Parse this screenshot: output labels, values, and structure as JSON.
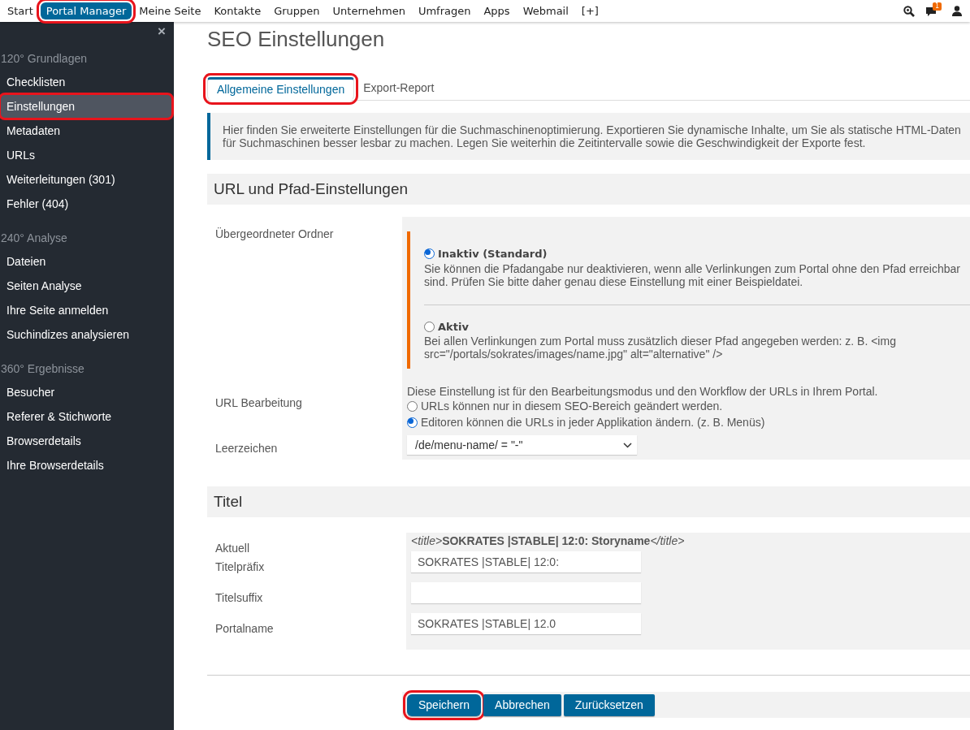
{
  "top_nav": {
    "items": [
      {
        "label": "Start",
        "selected": false,
        "highlighted": false
      },
      {
        "label": "Portal Manager",
        "selected": true,
        "highlighted": true
      },
      {
        "label": "Meine Seite",
        "selected": false,
        "highlighted": false
      },
      {
        "label": "Kontakte",
        "selected": false,
        "highlighted": false
      },
      {
        "label": "Gruppen",
        "selected": false,
        "highlighted": false
      },
      {
        "label": "Unternehmen",
        "selected": false,
        "highlighted": false
      },
      {
        "label": "Umfragen",
        "selected": false,
        "highlighted": false
      },
      {
        "label": "Apps",
        "selected": false,
        "highlighted": false
      },
      {
        "label": "Webmail",
        "selected": false,
        "highlighted": false
      },
      {
        "label": "[+]",
        "selected": false,
        "highlighted": false
      }
    ],
    "message_badge": "1"
  },
  "sidebar": {
    "close": "×",
    "sections": [
      {
        "title": "120° Grundlagen",
        "items": [
          {
            "label": "Checklisten",
            "selected": false,
            "highlighted": false
          },
          {
            "label": "Einstellungen",
            "selected": true,
            "highlighted": true
          },
          {
            "label": "Metadaten",
            "selected": false,
            "highlighted": false
          },
          {
            "label": "URLs",
            "selected": false,
            "highlighted": false
          },
          {
            "label": "Weiterleitungen (301)",
            "selected": false,
            "highlighted": false
          },
          {
            "label": "Fehler (404)",
            "selected": false,
            "highlighted": false
          }
        ]
      },
      {
        "title": "240° Analyse",
        "items": [
          {
            "label": "Dateien",
            "selected": false,
            "highlighted": false
          },
          {
            "label": "Seiten Analyse",
            "selected": false,
            "highlighted": false
          },
          {
            "label": "Ihre Seite anmelden",
            "selected": false,
            "highlighted": false
          },
          {
            "label": "Suchindizes analysieren",
            "selected": false,
            "highlighted": false
          }
        ]
      },
      {
        "title": "360° Ergebnisse",
        "items": [
          {
            "label": "Besucher",
            "selected": false,
            "highlighted": false
          },
          {
            "label": "Referer & Stichworte",
            "selected": false,
            "highlighted": false
          },
          {
            "label": "Browserdetails",
            "selected": false,
            "highlighted": false
          },
          {
            "label": "Ihre Browserdetails",
            "selected": false,
            "highlighted": false
          }
        ]
      }
    ]
  },
  "page_title": "SEO Einstellungen",
  "tabs": [
    {
      "label": "Allgemeine Einstellungen",
      "selected": true,
      "highlighted": true
    },
    {
      "label": "Export-Report",
      "selected": false,
      "highlighted": false
    }
  ],
  "info": "Hier finden Sie erweiterte Einstellungen für die Suchmaschinenoptimierung. Exportieren Sie dynamische Inhalte, um Sie als statische HTML-Daten für Suchmaschinen besser lesbar zu machen. Legen Sie weiterhin die Zeitintervalle sowie die Geschwindigkeit der Exporte fest.",
  "url_section": {
    "title": "URL und Pfad-Einstellungen",
    "parent_folder": {
      "label": "Übergeordneter Ordner",
      "options": [
        {
          "label": "Inaktiv (Standard)",
          "description": "Sie können die Pfadangabe nur deaktivieren, wenn alle Verlinkungen zum Portal ohne den Pfad erreichbar sind. Prüfen Sie bitte daher genau diese Einstellung mit einer Beispieldatei.",
          "selected": true
        },
        {
          "label": "Aktiv",
          "description": "Bei allen Verlinkungen zum Portal muss zusätzlich dieser Pfad angegeben werden: z. B. <img src=\"/portals/sokrates/images/name.jpg\" alt=\"alternative\" />",
          "selected": false
        }
      ]
    },
    "url_editing": {
      "label": "URL Bearbeitung",
      "description": "Diese Einstellung ist für den Bearbeitungsmodus und den Workflow der URLs in Ihrem Portal.",
      "options": [
        {
          "label": "URLs können nur in diesem SEO-Bereich geändert werden.",
          "selected": false
        },
        {
          "label": "Editoren können die URLs in jeder Applikation ändern. (z. B. Menüs)",
          "selected": true
        }
      ]
    },
    "spaces": {
      "label": "Leerzeichen",
      "value": "/de/menu-name/ = \"-\""
    }
  },
  "title_section": {
    "title": "Titel",
    "current_label": "Aktuell",
    "current": {
      "open_tag": "<title>",
      "value": "SOKRATES |STABLE| 12:0: Storyname",
      "close_tag": "</title>"
    },
    "fields": [
      {
        "label": "Titelpräfix",
        "value": "SOKRATES |STABLE| 12:0:"
      },
      {
        "label": "Titelsuffix"
      },
      {
        "label": "Portalname",
        "value": "SOKRATES |STABLE| 12.0"
      }
    ]
  },
  "buttons": [
    {
      "label": "Speichern",
      "highlighted": true
    },
    {
      "label": "Abbrechen",
      "highlighted": false
    },
    {
      "label": "Zurücksetzen",
      "highlighted": false
    }
  ]
}
